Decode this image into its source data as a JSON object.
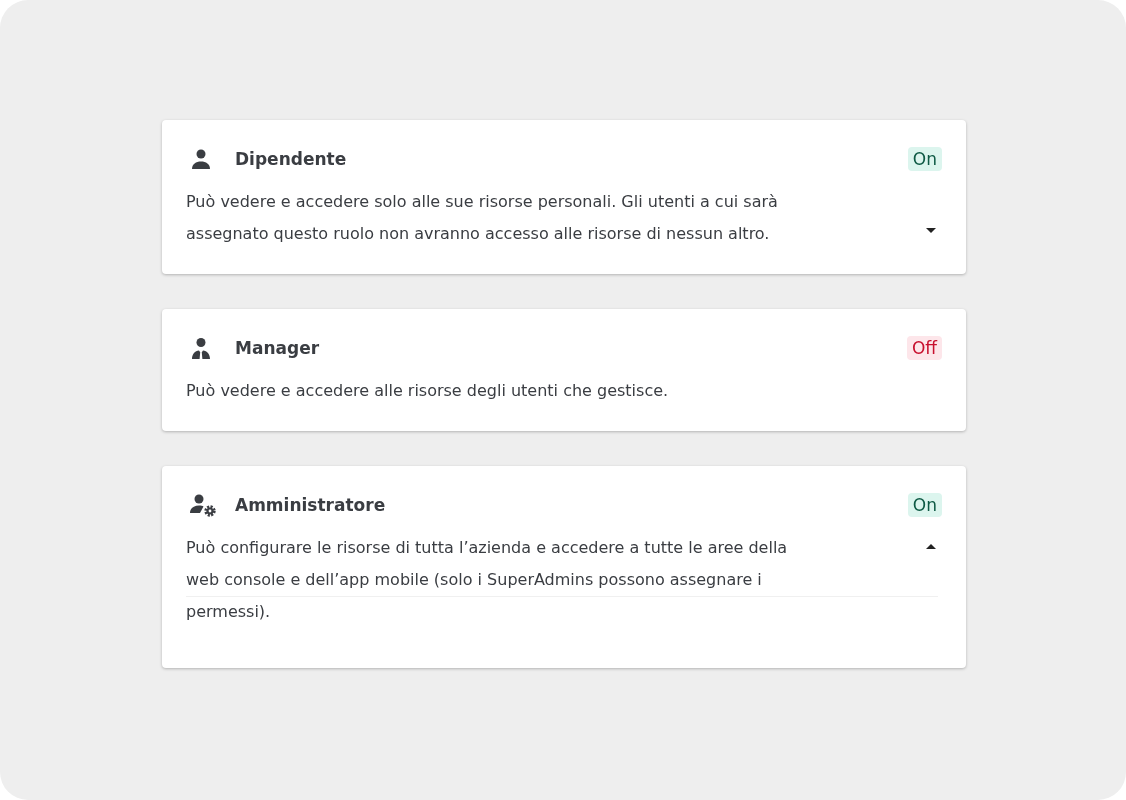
{
  "roles": [
    {
      "kind": "employee",
      "title": "Dipendente",
      "status": "On",
      "on": true,
      "description": "Può vedere e accedere solo alle sue risorse personali. Gli utenti a cui sarà assegnato questo ruolo non avranno accesso alle risorse di nessun altro.",
      "expanded": false
    },
    {
      "kind": "manager",
      "title": "Manager",
      "status": "Off",
      "on": false,
      "description": "Può vedere e accedere alle risorse degli utenti che gestisce."
    },
    {
      "kind": "admin",
      "title": "Amministratore",
      "status": "On",
      "on": true,
      "description": "Può configurare le risorse di tutta l’azienda e accedere a tutte le aree della web console e dell’app mobile (solo i SuperAdmins possono assegnare i permessi).",
      "expanded": true
    }
  ]
}
